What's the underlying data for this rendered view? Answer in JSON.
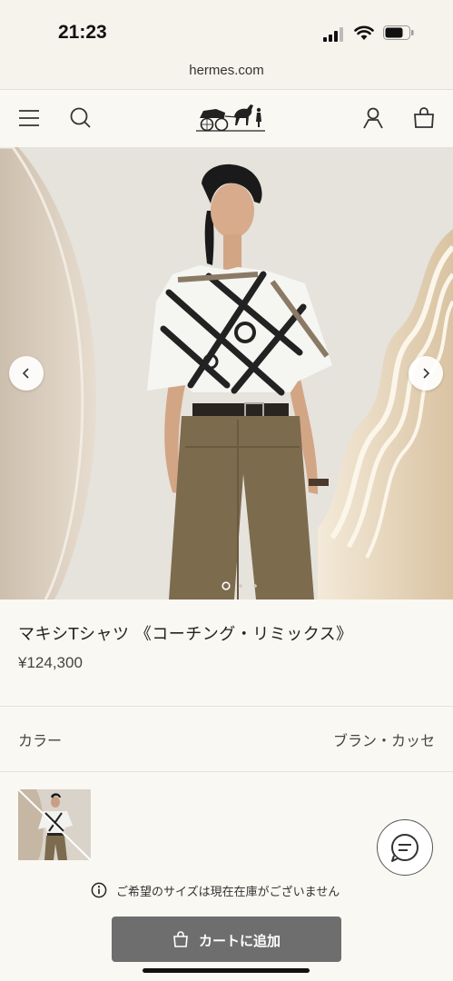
{
  "status_bar": {
    "time": "21:23"
  },
  "browser": {
    "url": "hermes.com"
  },
  "header": {
    "menu_icon": "hamburger-icon",
    "search_icon": "search-icon",
    "logo": "hermes-carriage-logo",
    "account_icon": "person-icon",
    "bag_icon": "shopping-bag-icon"
  },
  "carousel": {
    "slide_count": 3,
    "active_index": 0
  },
  "product": {
    "title": "マキシTシャツ 《コーチング・リミックス》",
    "price": "¥124,300",
    "color_label": "カラー",
    "color_value": "ブラン・カッセ"
  },
  "stock_notice": "ご希望のサイズは現在在庫がございません",
  "cart": {
    "label": "カートに追加"
  },
  "colors": {
    "background": "#faf8f3",
    "button": "#6e6e6e"
  }
}
